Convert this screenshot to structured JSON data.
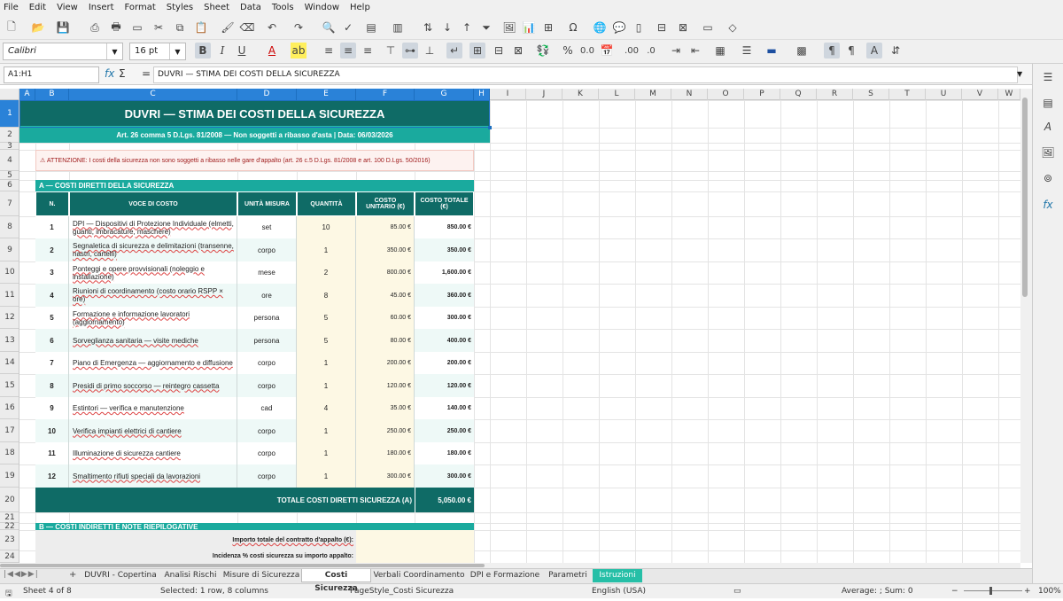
{
  "menu": [
    "File",
    "Edit",
    "View",
    "Insert",
    "Format",
    "Styles",
    "Sheet",
    "Data",
    "Tools",
    "Window",
    "Help"
  ],
  "toolbar": {
    "font_name": "Calibri",
    "font_size": "16 pt"
  },
  "formula_bar": {
    "name_box": "A1:H1",
    "formula": "DUVRI — STIMA DEI COSTI DELLA SICUREZZA"
  },
  "columns": [
    "A",
    "B",
    "C",
    "D",
    "E",
    "F",
    "G",
    "H",
    "I",
    "J",
    "K",
    "L",
    "M",
    "N",
    "O",
    "P",
    "Q",
    "R",
    "S",
    "T",
    "U",
    "V",
    "W"
  ],
  "row_numbers": [
    "1",
    "2",
    "3",
    "4",
    "5",
    "6",
    "7",
    "8",
    "9",
    "10",
    "11",
    "12",
    "13",
    "14",
    "15",
    "16",
    "17",
    "18",
    "19",
    "20",
    "21",
    "22",
    "23",
    "24"
  ],
  "sheet": {
    "title": "DUVRI — STIMA DEI COSTI DELLA SICUREZZA",
    "subtitle": "Art. 26 comma 5 D.Lgs. 81/2008 — Non soggetti a ribasso d'asta  |  Data: 06/03/2026",
    "warning": "⚠ ATTENZIONE: I costi della sicurezza non sono soggetti a ribasso nelle gare d'appalto (art. 26 c.5 D.Lgs. 81/2008 e art. 100 D.Lgs. 50/2016)",
    "section_a": "A — COSTI DIRETTI DELLA SICUREZZA",
    "headers": [
      "N.",
      "VOCE DI COSTO",
      "UNITÀ MISURA",
      "QUANTITÀ",
      "COSTO UNITARIO (€)",
      "COSTO TOTALE (€)"
    ],
    "rows": [
      {
        "n": "1",
        "voce": "DPI — Dispositivi di Protezione Individuale (elmetti, guanti, imbracature, maschere)",
        "um": "set",
        "qty": "10",
        "unit": "85.00 €",
        "tot": "850.00 €"
      },
      {
        "n": "2",
        "voce": "Segnaletica di sicurezza e delimitazioni (transenne, nastri, cartelli)",
        "um": "corpo",
        "qty": "1",
        "unit": "350.00 €",
        "tot": "350.00 €"
      },
      {
        "n": "3",
        "voce": "Ponteggi e opere provvisionali (noleggio e installazione)",
        "um": "mese",
        "qty": "2",
        "unit": "800.00 €",
        "tot": "1,600.00 €"
      },
      {
        "n": "4",
        "voce": "Riunioni di coordinamento (costo orario RSPP × ore)",
        "um": "ore",
        "qty": "8",
        "unit": "45.00 €",
        "tot": "360.00 €"
      },
      {
        "n": "5",
        "voce": "Formazione e informazione lavoratori (aggiornamento)",
        "um": "persona",
        "qty": "5",
        "unit": "60.00 €",
        "tot": "300.00 €"
      },
      {
        "n": "6",
        "voce": "Sorveglianza sanitaria — visite mediche",
        "um": "persona",
        "qty": "5",
        "unit": "80.00 €",
        "tot": "400.00 €"
      },
      {
        "n": "7",
        "voce": "Piano di Emergenza — aggiornamento e diffusione",
        "um": "corpo",
        "qty": "1",
        "unit": "200.00 €",
        "tot": "200.00 €"
      },
      {
        "n": "8",
        "voce": "Presidi di primo soccorso — reintegro cassetta",
        "um": "corpo",
        "qty": "1",
        "unit": "120.00 €",
        "tot": "120.00 €"
      },
      {
        "n": "9",
        "voce": "Estintori — verifica e manutenzione",
        "um": "cad",
        "qty": "4",
        "unit": "35.00 €",
        "tot": "140.00 €"
      },
      {
        "n": "10",
        "voce": "Verifica impianti elettrici di cantiere",
        "um": "corpo",
        "qty": "1",
        "unit": "250.00 €",
        "tot": "250.00 €"
      },
      {
        "n": "11",
        "voce": "Illuminazione di sicurezza cantiere",
        "um": "corpo",
        "qty": "1",
        "unit": "180.00 €",
        "tot": "180.00 €"
      },
      {
        "n": "12",
        "voce": "Smaltimento rifiuti speciali da lavorazioni",
        "um": "corpo",
        "qty": "1",
        "unit": "300.00 €",
        "tot": "300.00 €"
      }
    ],
    "total_label": "TOTALE COSTI DIRETTI SICUREZZA (A)",
    "total_value": "5,050.00 €",
    "section_b": "B — COSTI INDIRETTI E NOTE RIEPILOGATIVE",
    "b_row1": "Importo totale del contratto d'appalto (€):",
    "b_row2": "Incidenza % costi sicurezza su importo appalto:"
  },
  "tabs": [
    "DUVRI - Copertina",
    "Analisi Rischi",
    "Misure di Sicurezza",
    "Costi Sicurezza",
    "Verbali Coordinamento",
    "DPI e Formazione",
    "Parametri",
    "Istruzioni"
  ],
  "status": {
    "sheet": "Sheet 4 of 8",
    "selected": "Selected: 1 row, 8 columns",
    "page_style": "PageStyle_Costi Sicurezza",
    "language": "English (USA)",
    "average": "Average: ; Sum: 0",
    "zoom": "100%"
  },
  "colors": {
    "teal_dark": "#0f6b66",
    "teal": "#1aaa9e",
    "accent_green": "#26bfa7",
    "header_blue": "#2a82d8"
  }
}
